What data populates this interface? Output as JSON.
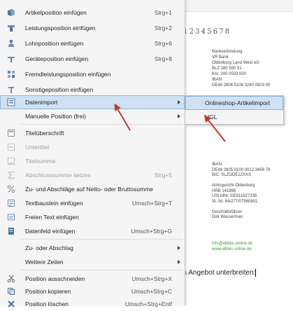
{
  "colors": {
    "menu_bg": "#f5f5f5",
    "highlight": "#cfe1f3",
    "highlight_border": "#8fb6dc",
    "annotation_arrow": "#c0392b",
    "green_text": "#2f9e2f"
  },
  "document": {
    "ruler_text": "1 2 3 4 5 6 7 8",
    "bank_lines": [
      "Bankverbindung:",
      "VR Bank",
      "Oldenburg Land West eG",
      "BLZ 280 590 51",
      "Kto. 240 0503 000",
      "IBAN:",
      "DE48 2806 5108 0240 0503 00"
    ],
    "bank2_lines": [
      "IBAN:",
      "DE48 2805 0100 0012 3456 78",
      "BIC: SLZODE22XXX",
      "",
      "Amtsgericht Oldenburg",
      "HRB 141896",
      "USt-IdNr. DE811627335",
      "St.-Nr. 64/277/07960801",
      "",
      "Geschäftsführer:",
      "Dirk Wasserman"
    ],
    "green_lines": [
      "info@elbtec-online.de",
      "www.elbtec-online.de"
    ],
    "bottom_text": "s Angebot unterbreiten:"
  },
  "menu": {
    "items": [
      {
        "label": "Artikelposition einfügen",
        "shortcut": "Strg+1",
        "icon": "article-icon",
        "disabled": false
      },
      {
        "label": "Leistungsposition einfügen",
        "shortcut": "Strg+2",
        "icon": "service-icon",
        "disabled": false
      },
      {
        "label": "Lohnposition einfügen",
        "shortcut": "Strg+6",
        "icon": "wage-person-icon",
        "disabled": false
      },
      {
        "label": "Geräteposition einfügen",
        "shortcut": "Strg+8",
        "icon": "equipment-icon",
        "disabled": false
      },
      {
        "label": "Fremdleistungsposition einfügen",
        "shortcut": "",
        "icon": "external-service-icon",
        "disabled": false
      },
      {
        "label": "Sonstigeposition einfügen",
        "shortcut": "",
        "icon": "misc-position-icon",
        "disabled": false
      },
      {
        "label": "Datenimport",
        "shortcut": "",
        "icon": "data-import-icon",
        "disabled": false,
        "submenu": true,
        "highlighted": true
      },
      {
        "label": "Manuelle Position (frei)",
        "shortcut": "",
        "icon": "",
        "disabled": false,
        "submenu": true
      },
      {
        "label": "Titelüberschrift",
        "shortcut": "",
        "icon": "title-heading-icon",
        "disabled": false
      },
      {
        "label": "Untertitel",
        "shortcut": "",
        "icon": "subtitle-icon",
        "disabled": true
      },
      {
        "label": "Titelsumme",
        "shortcut": "",
        "icon": "title-sum-icon",
        "disabled": true
      },
      {
        "label": "Abschlusssumme setzen",
        "shortcut": "Strg+5",
        "icon": "sum-sigma-icon",
        "disabled": true
      },
      {
        "label": "Zu- und Abschläge auf Netto- oder Bruttosumme",
        "shortcut": "",
        "icon": "percent-icon",
        "disabled": false
      },
      {
        "label": "Textbaustein einfügen",
        "shortcut": "Umsch+Strg+T",
        "icon": "text-block-icon",
        "disabled": false
      },
      {
        "label": "Freien Text einfügen",
        "shortcut": "",
        "icon": "free-text-icon",
        "disabled": false
      },
      {
        "label": "Datenfeld einfügen",
        "shortcut": "Umsch+Strg+G",
        "icon": "data-field-icon",
        "disabled": false
      },
      {
        "label": "Zu- oder Abschlag",
        "shortcut": "",
        "icon": "",
        "disabled": false,
        "submenu": true
      },
      {
        "label": "Weitere Zeilen",
        "shortcut": "",
        "icon": "",
        "disabled": false,
        "submenu": true
      },
      {
        "label": "Position ausschneiden",
        "shortcut": "Umsch+Strg+X",
        "icon": "scissors-icon",
        "disabled": false
      },
      {
        "label": "Position kopieren",
        "shortcut": "Umsch+Strg+C",
        "icon": "copy-icon",
        "disabled": false
      },
      {
        "label": "Position löschen",
        "shortcut": "Umsch+Strg+Entf",
        "icon": "delete-x-icon",
        "disabled": false
      }
    ]
  },
  "submenu": {
    "items": [
      {
        "label": "Onlineshop-Artikelimport",
        "highlighted": true
      },
      {
        "label": "UGL",
        "highlighted": false
      }
    ]
  }
}
